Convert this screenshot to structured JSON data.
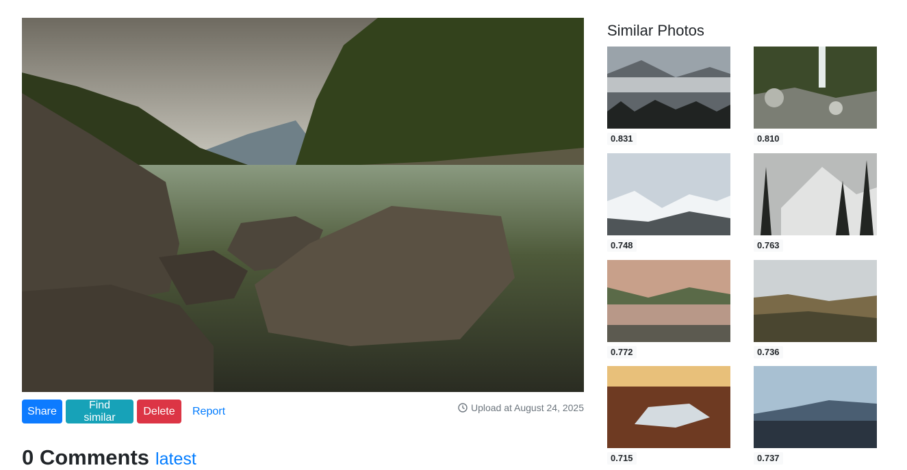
{
  "actions": {
    "share_label": "Share",
    "find_similar_label": "Find similar",
    "delete_label": "Delete",
    "report_label": "Report"
  },
  "upload": {
    "text": "Upload at August 24, 2025",
    "icon": "clock-icon"
  },
  "comments": {
    "count_label": "0 Comments",
    "latest_label": "latest"
  },
  "sidebar": {
    "title": "Similar Photos",
    "items": [
      {
        "score": "0.831",
        "subject": "misty mountains with pine trees"
      },
      {
        "score": "0.810",
        "subject": "waterfall over mossy rocks"
      },
      {
        "score": "0.748",
        "subject": "snowy mountain peaks"
      },
      {
        "score": "0.763",
        "subject": "pines in front of snowy mountains"
      },
      {
        "score": "0.772",
        "subject": "sunset over mountain lake"
      },
      {
        "score": "0.736",
        "subject": "hills under cloudy sky"
      },
      {
        "score": "0.715",
        "subject": "sunrise over wet road"
      },
      {
        "score": "0.737",
        "subject": "valley with clouds below mountains"
      }
    ]
  },
  "colors": {
    "primary": "#0d7bff",
    "info": "#17a2b8",
    "danger": "#dc3545",
    "link": "#007bff",
    "muted": "#6c757d"
  }
}
